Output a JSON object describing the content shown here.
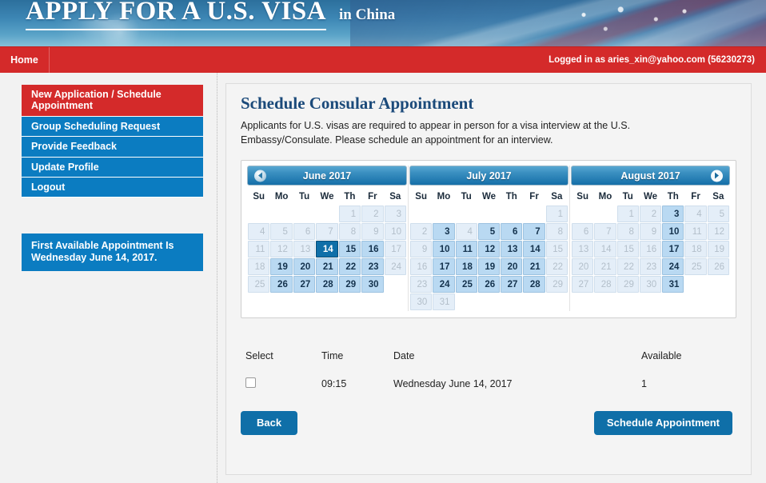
{
  "header": {
    "title": "APPLY FOR A U.S. VISA",
    "subtitle": "in China",
    "nav_home": "Home",
    "logged_in": "Logged in as  aries_xin@yahoo.com (56230273)"
  },
  "sidebar": {
    "items": [
      {
        "label": "New Application / Schedule Appointment",
        "active": true
      },
      {
        "label": "Group Scheduling Request",
        "active": false
      },
      {
        "label": "Provide Feedback",
        "active": false
      },
      {
        "label": "Update Profile",
        "active": false
      },
      {
        "label": "Logout",
        "active": false
      }
    ],
    "info_box": "First Available Appointment Is Wednesday June 14, 2017."
  },
  "main": {
    "title": "Schedule Consular Appointment",
    "description": "Applicants for U.S. visas are required to appear in person for a visa interview at the U.S. Embassy/Consulate. Please schedule an appointment for an interview.",
    "prev_arrow": "prev-month-arrow",
    "next_arrow": "next-month-arrow",
    "weekdays": [
      "Su",
      "Mo",
      "Tu",
      "We",
      "Th",
      "Fr",
      "Sa"
    ],
    "calendars": [
      {
        "month_label": "June 2017",
        "first_weekday": 4,
        "days_in_month": 30,
        "available": [
          15,
          16,
          19,
          20,
          21,
          22,
          23,
          26,
          27,
          28,
          29,
          30
        ],
        "selected": [
          14
        ]
      },
      {
        "month_label": "July 2017",
        "first_weekday": 6,
        "days_in_month": 31,
        "available": [
          3,
          5,
          6,
          7,
          10,
          11,
          12,
          13,
          14,
          17,
          18,
          19,
          20,
          21,
          24,
          25,
          26,
          27,
          28
        ],
        "selected": []
      },
      {
        "month_label": "August 2017",
        "first_weekday": 2,
        "days_in_month": 31,
        "available": [
          3,
          10,
          17,
          24,
          31
        ],
        "selected": []
      }
    ],
    "slot_table": {
      "headers": [
        "Select",
        "Time",
        "Date",
        "Available"
      ],
      "rows": [
        {
          "time": "09:15",
          "date": "Wednesday June 14, 2017",
          "available": "1",
          "checked": false
        }
      ]
    },
    "buttons": {
      "back": "Back",
      "schedule": "Schedule Appointment"
    }
  },
  "colors": {
    "brand_red": "#d42a2a",
    "brand_blue": "#0b7cc1",
    "selected_day": "#0f6fa8",
    "available_day": "#b9d9f2",
    "disabled_day": "#e4eef8",
    "page_bg": "#f2f2f2"
  }
}
